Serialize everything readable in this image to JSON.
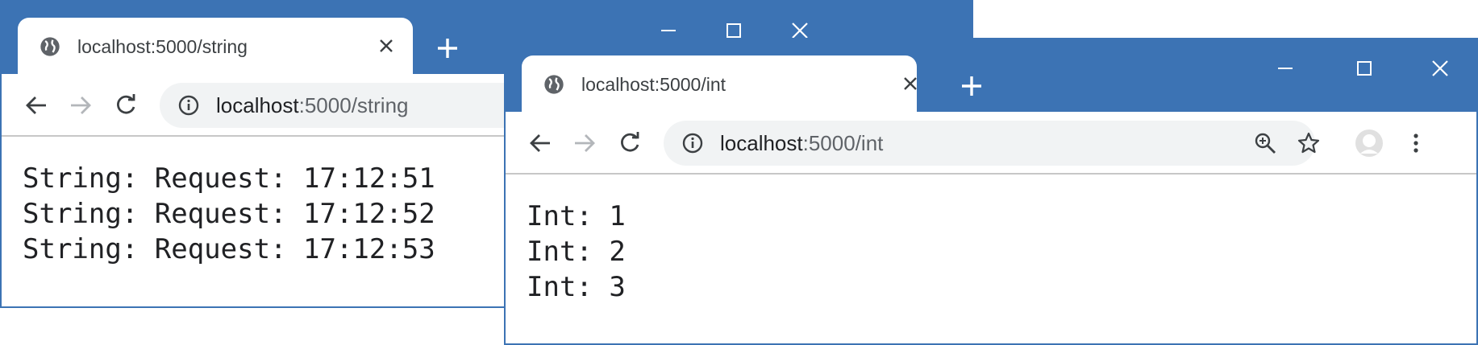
{
  "colors": {
    "frame": "#3c73b4",
    "omnibox_bg": "#f1f3f4",
    "text": "#202124",
    "muted": "#5f6368"
  },
  "back_window": {
    "tab": {
      "title": "localhost:5000/string",
      "favicon": "globe-icon",
      "close": "close-icon"
    },
    "address": {
      "host": "localhost",
      "path": ":5000/string"
    },
    "lines": [
      "String: Request: 17:12:51",
      "String: Request: 17:12:52",
      "String: Request: 17:12:53"
    ]
  },
  "front_window": {
    "tab": {
      "title": "localhost:5000/int",
      "favicon": "globe-icon",
      "close": "close-icon"
    },
    "address": {
      "host": "localhost",
      "path": ":5000/int"
    },
    "lines": [
      "Int: 1",
      "Int: 2",
      "Int: 3"
    ]
  }
}
